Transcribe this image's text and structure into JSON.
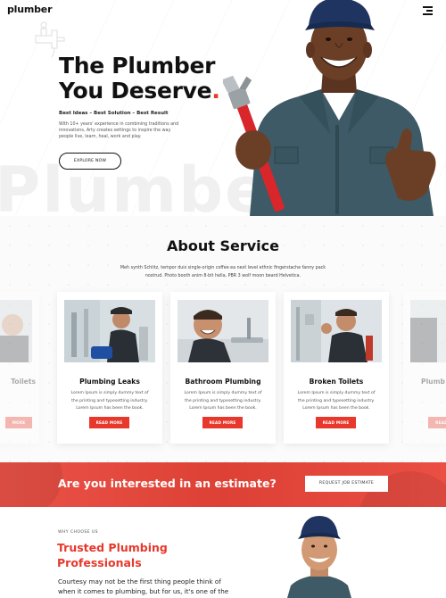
{
  "header": {
    "logo": "plumber",
    "menu_icon": "hamburger-icon"
  },
  "hero": {
    "background_word": "Plumber",
    "title_line1": "The Plumber",
    "title_line2": "You Deserve",
    "title_dot": ".",
    "tagline": "Best Ideas – Best Solution – Best Result",
    "description": "With 10+ years' experience in combining traditions and innovations, Arty creates settings to inspire the way people live, learn, heal, work and play.",
    "cta_label": "EXPLORE NOW"
  },
  "about": {
    "title": "About Service",
    "description": "Meh synth Schlitz, tempor duis single-origin coffee ea next level ethnic fingerstache fanny pack nostrud. Photo booth anim 8-bit hella, PBR 3 wolf moon beard Helvetica.",
    "cards": [
      {
        "title": "Toilets",
        "text": "",
        "button": "MORE"
      },
      {
        "title": "Plumbing Leaks",
        "text": "Lorem Ipsum is simply dummy text of the printing and typesetting industry. Lorem Ipsum has been the book.",
        "button": "READ MORE"
      },
      {
        "title": "Bathroom Plumbing",
        "text": "Lorem Ipsum is simply dummy text of the printing and typesetting industry. Lorem Ipsum has been the book.",
        "button": "READ MORE"
      },
      {
        "title": "Broken Toilets",
        "text": "Lorem Ipsum is simply dummy text of the printing and typesetting industry. Lorem Ipsum has been the book.",
        "button": "READ MORE"
      },
      {
        "title": "Plumb",
        "text": "",
        "button": "READ"
      }
    ]
  },
  "cta": {
    "text": "Are you interested in an estimate?",
    "button": "REQUEST JOB ESTIMATE"
  },
  "why": {
    "label": "WHY CHOOSE US",
    "title_line1": "Trusted Plumbing",
    "title_line2": "Professionals",
    "text": "Courtesy may not be the first thing people think of when it comes to plumbing, but for us, it's one of the most important tools we carry."
  },
  "colors": {
    "accent": "#e8382b",
    "text": "#111111"
  }
}
